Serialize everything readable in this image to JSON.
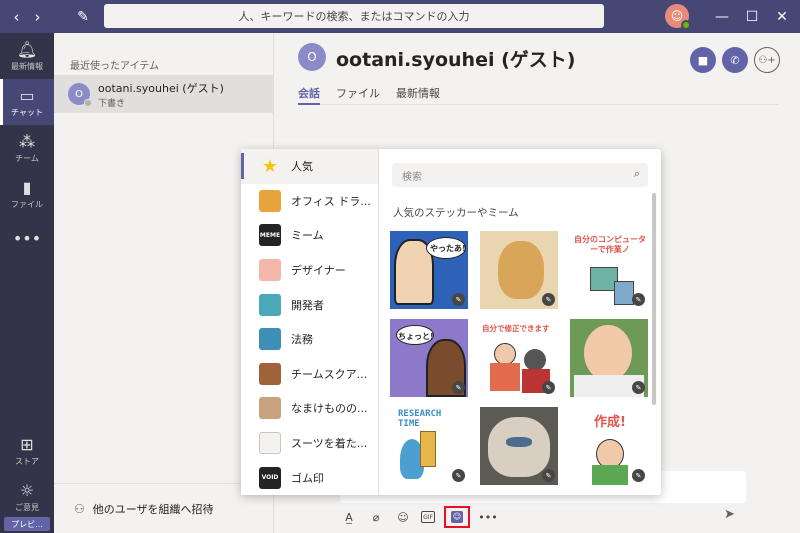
{
  "titlebar": {
    "search_placeholder": "人、キーワードの検索、またはコマンドの入力",
    "colors": {
      "bar": "#464775",
      "rail": "#33344a",
      "accent": "#6264a7"
    }
  },
  "rail": {
    "items": [
      {
        "label": "最新情報",
        "icon": "bell-icon"
      },
      {
        "label": "チャット",
        "icon": "chat-icon"
      },
      {
        "label": "チーム",
        "icon": "teams-icon"
      },
      {
        "label": "ファイル",
        "icon": "file-icon"
      }
    ],
    "store_label": "ストア",
    "feedback_label": "ご意見",
    "preview_label": "プレビ..."
  },
  "chatlist": {
    "recent_header": "最近使ったアイテム",
    "items": [
      {
        "avatar": "O",
        "name": "ootani.syouhei (ゲスト)",
        "sub": "下書き"
      }
    ],
    "invite_label": "他のユーザを組織へ招待"
  },
  "main": {
    "avatar": "O",
    "title": "ootani.syouhei (ゲスト)",
    "tabs": [
      "会話",
      "ファイル",
      "最新情報"
    ]
  },
  "picker": {
    "search_placeholder": "検索",
    "header": "人気のステッカーやミーム",
    "categories": [
      "人気",
      "オフィス ドラ...",
      "ミーム",
      "デザイナー",
      "開発者",
      "法務",
      "チームスクア...",
      "なまけものの...",
      "スーツを着た...",
      "ゴム印"
    ],
    "stickers": {
      "yatta": "やったあ!",
      "computer": "自分のコンピューターで作業ノ",
      "chotto": "ちょっと!",
      "shusei": "自分で修正できます",
      "research": "RESEARCH TIME",
      "sakusei": "作成!"
    }
  }
}
